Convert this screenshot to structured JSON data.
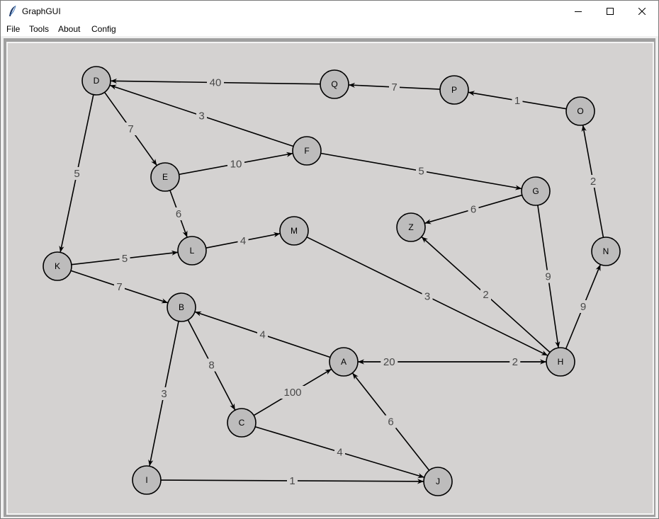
{
  "window": {
    "title": "GraphGUI"
  },
  "menu": [
    {
      "label": "File"
    },
    {
      "label": "Tools"
    },
    {
      "label": "About"
    },
    {
      "label": "Config"
    }
  ],
  "graph": {
    "nodes": [
      {
        "id": "D"
      },
      {
        "id": "Q"
      },
      {
        "id": "P"
      },
      {
        "id": "O"
      },
      {
        "id": "E"
      },
      {
        "id": "F"
      },
      {
        "id": "G"
      },
      {
        "id": "Z"
      },
      {
        "id": "M"
      },
      {
        "id": "L"
      },
      {
        "id": "K"
      },
      {
        "id": "N"
      },
      {
        "id": "B"
      },
      {
        "id": "A"
      },
      {
        "id": "H"
      },
      {
        "id": "C"
      },
      {
        "id": "I"
      },
      {
        "id": "J"
      }
    ],
    "edges": [
      {
        "from": "Q",
        "to": "D",
        "weight": "40"
      },
      {
        "from": "P",
        "to": "Q",
        "weight": "7"
      },
      {
        "from": "O",
        "to": "P",
        "weight": "1"
      },
      {
        "from": "N",
        "to": "O",
        "weight": "2"
      },
      {
        "from": "F",
        "to": "D",
        "weight": "3"
      },
      {
        "from": "D",
        "to": "E",
        "weight": "7"
      },
      {
        "from": "D",
        "to": "K",
        "weight": "5"
      },
      {
        "from": "E",
        "to": "F",
        "weight": "10"
      },
      {
        "from": "F",
        "to": "G",
        "weight": "5"
      },
      {
        "from": "E",
        "to": "L",
        "weight": "6"
      },
      {
        "from": "G",
        "to": "Z",
        "weight": "6"
      },
      {
        "from": "L",
        "to": "M",
        "weight": "4"
      },
      {
        "from": "K",
        "to": "L",
        "weight": "5"
      },
      {
        "from": "K",
        "to": "B",
        "weight": "7"
      },
      {
        "from": "M",
        "to": "H",
        "weight": "3"
      },
      {
        "from": "H",
        "to": "Z",
        "weight": "2"
      },
      {
        "from": "G",
        "to": "H",
        "weight": "9"
      },
      {
        "from": "H",
        "to": "N",
        "weight": "9"
      },
      {
        "from": "A",
        "to": "B",
        "weight": "4"
      },
      {
        "from": "H",
        "to": "A",
        "weight": "20"
      },
      {
        "from": "A",
        "to": "H",
        "weight": "2"
      },
      {
        "from": "B",
        "to": "C",
        "weight": "8"
      },
      {
        "from": "C",
        "to": "A",
        "weight": "100"
      },
      {
        "from": "B",
        "to": "I",
        "weight": "3"
      },
      {
        "from": "J",
        "to": "A",
        "weight": "6"
      },
      {
        "from": "C",
        "to": "J",
        "weight": "4"
      },
      {
        "from": "I",
        "to": "J",
        "weight": "1"
      }
    ]
  }
}
